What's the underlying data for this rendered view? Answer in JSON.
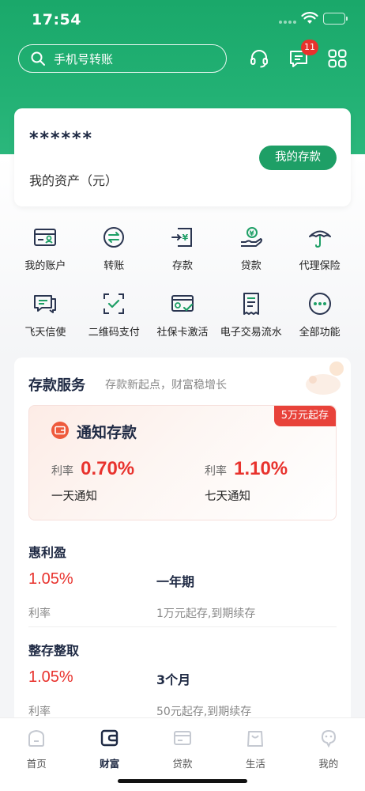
{
  "status_bar": {
    "time": "17:54"
  },
  "header": {
    "search_placeholder": "手机号转账",
    "message_badge": "11",
    "icons": [
      "headset-icon",
      "message-icon",
      "apps-grid-icon"
    ]
  },
  "asset_card": {
    "masked_amount": "******",
    "label": "我的资产（元）",
    "button_label": "我的存款"
  },
  "shortcuts": [
    {
      "label": "我的账户",
      "icon": "account-card-icon"
    },
    {
      "label": "转账",
      "icon": "transfer-icon"
    },
    {
      "label": "存款",
      "icon": "deposit-icon"
    },
    {
      "label": "贷款",
      "icon": "loan-icon"
    },
    {
      "label": "代理保险",
      "icon": "umbrella-icon"
    },
    {
      "label": "飞天信使",
      "icon": "chat-icon"
    },
    {
      "label": "二维码支付",
      "icon": "qr-scan-icon"
    },
    {
      "label": "社保卡激活",
      "icon": "social-card-icon"
    },
    {
      "label": "电子交易流水",
      "icon": "statement-icon"
    },
    {
      "label": "全部功能",
      "icon": "more-icon"
    }
  ],
  "deposit_service": {
    "title": "存款服务",
    "subtitle": "存款新起点，财富稳增长",
    "featured": {
      "name": "通知存款",
      "tag": "5万元起存",
      "rates": [
        {
          "label": "利率",
          "value": "0.70%",
          "desc": "一天通知"
        },
        {
          "label": "利率",
          "value": "1.10%",
          "desc": "七天通知"
        }
      ]
    },
    "products": [
      {
        "name": "惠利盈",
        "rate": "1.05%",
        "rate_label": "利率",
        "term": "一年期",
        "desc": "1万元起存,到期续存"
      },
      {
        "name": "整存整取",
        "rate": "1.05%",
        "rate_label": "利率",
        "term": "3个月",
        "desc": "50元起存,到期续存"
      }
    ]
  },
  "tabbar": [
    {
      "label": "首页",
      "icon": "home-icon",
      "active": false
    },
    {
      "label": "财富",
      "icon": "wallet-icon",
      "active": true
    },
    {
      "label": "贷款",
      "icon": "card-icon",
      "active": false
    },
    {
      "label": "生活",
      "icon": "bag-icon",
      "active": false
    },
    {
      "label": "我的",
      "icon": "profile-icon",
      "active": false
    }
  ],
  "colors": {
    "brand_green": "#22b174",
    "accent_red": "#e8322d",
    "button_green": "#1e9f66"
  }
}
